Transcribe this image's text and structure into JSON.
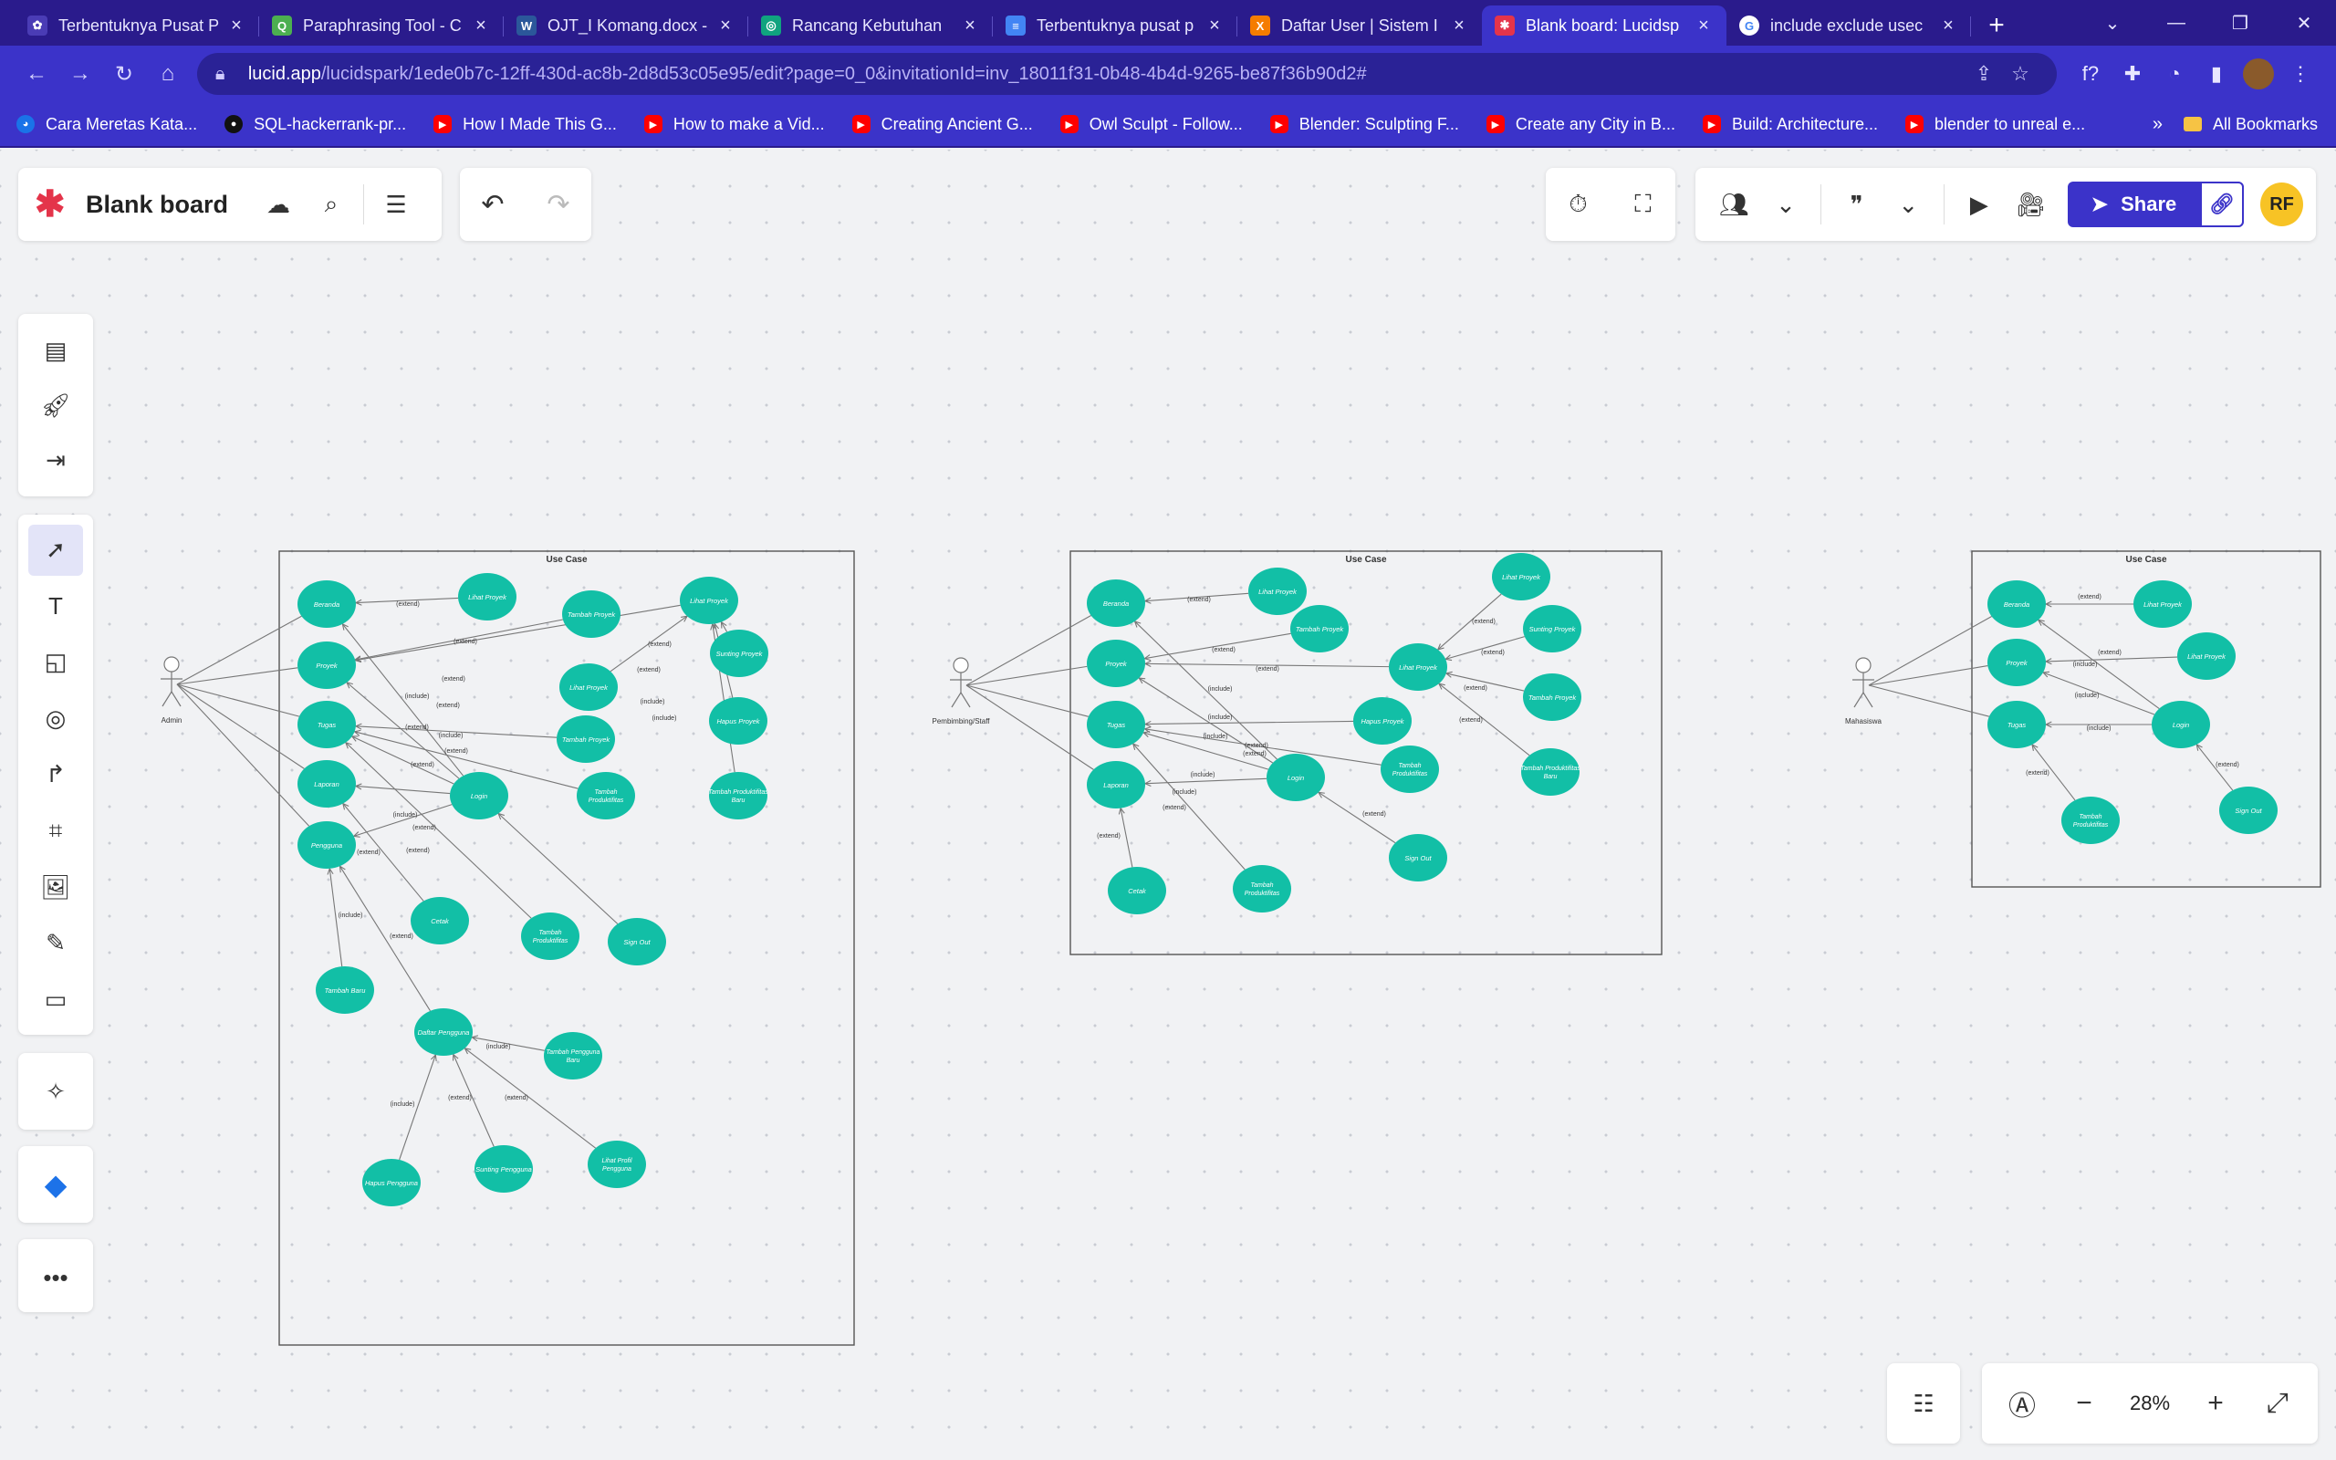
{
  "browser": {
    "tabs": [
      {
        "title": "Terbentuknya Pusat P",
        "color": "#4a3cb5",
        "glyph": "✿"
      },
      {
        "title": "Paraphrasing Tool - C",
        "color": "#4caf50",
        "glyph": "Q"
      },
      {
        "title": "OJT_I Komang.docx -",
        "color": "#2b579a",
        "glyph": "W"
      },
      {
        "title": "Rancang Kebutuhan",
        "color": "#10a37f",
        "glyph": "◎"
      },
      {
        "title": "Terbentuknya pusat p",
        "color": "#4285f4",
        "glyph": "≡"
      },
      {
        "title": "Daftar User | Sistem I",
        "color": "#f57c00",
        "glyph": "X"
      },
      {
        "title": "Blank board: Lucidsp",
        "color": "#e4344a",
        "glyph": "✱"
      },
      {
        "title": "include exclude usec",
        "color": "#ffffff",
        "glyph": "G"
      }
    ],
    "url_main": "lucid.app",
    "url_rest": "/lucidspark/1ede0b7c-12ff-430d-ac8b-2d8d53c05e95/edit?page=0_0&invitationId=inv_18011f31-0b48-4b4d-9265-be87f36b90d2#",
    "bookmarks": [
      {
        "label": "Cara Meretas Kata...",
        "icon": "bl"
      },
      {
        "label": "SQL-hackerrank-pr...",
        "icon": "gh"
      },
      {
        "label": "How I Made This G...",
        "icon": "yt"
      },
      {
        "label": "How to make a Vid...",
        "icon": "yt"
      },
      {
        "label": "Creating Ancient G...",
        "icon": "yt"
      },
      {
        "label": "Owl Sculpt - Follow...",
        "icon": "yt"
      },
      {
        "label": "Blender: Sculpting F...",
        "icon": "yt"
      },
      {
        "label": "Create any City in B...",
        "icon": "yt"
      },
      {
        "label": "Build: Architecture...",
        "icon": "yt"
      },
      {
        "label": "blender to unreal e...",
        "icon": "yt"
      }
    ],
    "bookmarks_more": "»",
    "all_bookmarks": "All Bookmarks"
  },
  "app": {
    "doc_title": "Blank board",
    "share_label": "Share",
    "user_initials": "RF",
    "zoom": "28%"
  },
  "colors": {
    "accent": "#3b33c9",
    "node": "#12bfa6",
    "brand": "#e4344a"
  },
  "diagrams": [
    {
      "title": "Use Case",
      "actor": "Admin",
      "nodes": [
        "Beranda",
        "Lihat Proyek",
        "Tambah Proyek",
        "Lihat Proyek",
        "Proyek",
        "Sunting Proyek",
        "Lihat Proyek",
        "Tugas",
        "Tambah Proyek",
        "Hapus Proyek",
        "Laporan",
        "Tambah Produktifitas",
        "Tambah Produktifitas Baru",
        "Login",
        "Pengguna",
        "Cetak",
        "Tambah Produktifitas",
        "Sign Out",
        "Tambah Baru",
        "Daftar Pengguna",
        "Tambah Pengguna Baru",
        "Hapus Pengguna",
        "Sunting Pengguna",
        "Lihat Profil Pengguna"
      ],
      "labels": [
        "(extend)",
        "(extend)",
        "(extend)",
        "(extend)",
        "(extend)",
        "(include)",
        "(extend)",
        "(include)",
        "(extend)",
        "(include)",
        "(extend)",
        "(include)",
        "(extend)",
        "(include)",
        "(extend)",
        "(extend)",
        "(include)",
        "(extend)",
        "(include)",
        "(include)",
        "(extend)",
        "(extend)",
        "(extend)",
        "(extend)",
        "(extend)"
      ]
    },
    {
      "title": "Use Case",
      "actor": "Pembimbing/Staff",
      "nodes": [
        "Beranda",
        "Lihat Proyek",
        "Tambah Proyek",
        "Lihat Proyek",
        "Proyek",
        "Sunting Proyek",
        "Lihat Proyek",
        "Tugas",
        "Tambah Proyek",
        "Hapus Proyek",
        "Laporan",
        "Tambah Produktifitas",
        "Tambah Produktifitas Baru",
        "Login",
        "Cetak",
        "Tambah Produktifitas",
        "Sign Out"
      ],
      "labels": [
        "(extend)",
        "(extend)",
        "(extend)",
        "(extend)",
        "(extend)",
        "(include)",
        "(extend)",
        "(extend)",
        "(include)",
        "(extend)",
        "(include)",
        "(include)",
        "(extend)",
        "(extend)",
        "(extend)",
        "(include)",
        "(extend)"
      ]
    },
    {
      "title": "Use Case",
      "actor": "Mahasiswa",
      "nodes": [
        "Beranda",
        "Lihat Proyek",
        "Proyek",
        "Lihat Proyek",
        "Tugas",
        "Login",
        "Tambah Produktifitas",
        "Sign Out"
      ],
      "labels": [
        "(extend)",
        "(extend)",
        "(include)",
        "(include)",
        "(include)",
        "(extend)",
        "(extend)"
      ]
    }
  ]
}
